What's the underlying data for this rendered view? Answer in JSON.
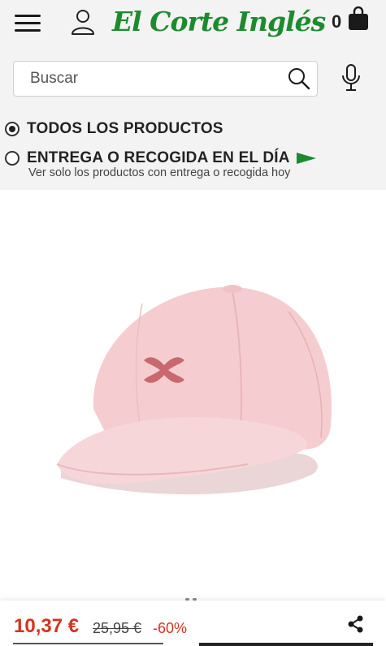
{
  "header": {
    "brand": "El Corte Inglés",
    "cart_count": "0"
  },
  "search": {
    "placeholder": "Buscar"
  },
  "filters": {
    "all_products": "TODOS LOS PRODUCTOS",
    "delivery_label": "ENTREGA O RECOGIDA EN EL DÍA",
    "delivery_sub": "Ver solo los productos con entrega o recogida hoy",
    "selected": "all_products"
  },
  "product": {
    "image_alt": "pink-cap",
    "price_current": "10,37 €",
    "price_old": "25,95 €",
    "discount": "-60%"
  },
  "colors": {
    "brand_green": "#1c8b2d",
    "price_red": "#d6331f",
    "cap_pink": "#f3c9cd"
  },
  "icons": [
    "menu-icon",
    "user-icon",
    "shopping-bag-icon",
    "search-icon",
    "microphone-icon",
    "green-flag-icon",
    "share-icon"
  ]
}
